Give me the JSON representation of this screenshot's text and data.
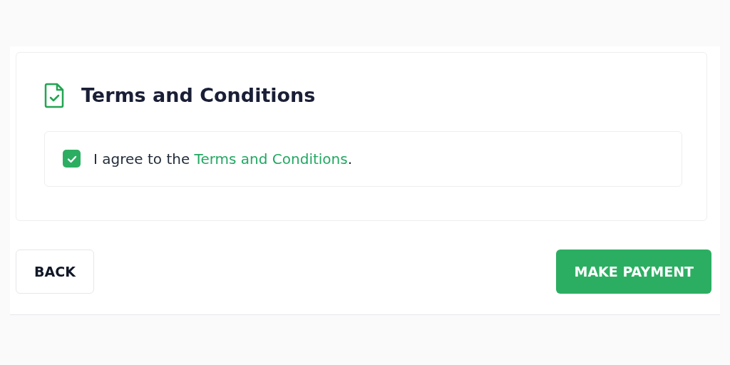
{
  "section": {
    "title": "Terms and Conditions"
  },
  "agreement": {
    "checked": true,
    "text_before": "I agree to the ",
    "link": "Terms and Conditions",
    "text_after": "."
  },
  "buttons": [
    {
      "label": "BACK",
      "kind": "secondary"
    },
    {
      "label": "MAKE PAYMENT",
      "kind": "primary"
    }
  ]
}
